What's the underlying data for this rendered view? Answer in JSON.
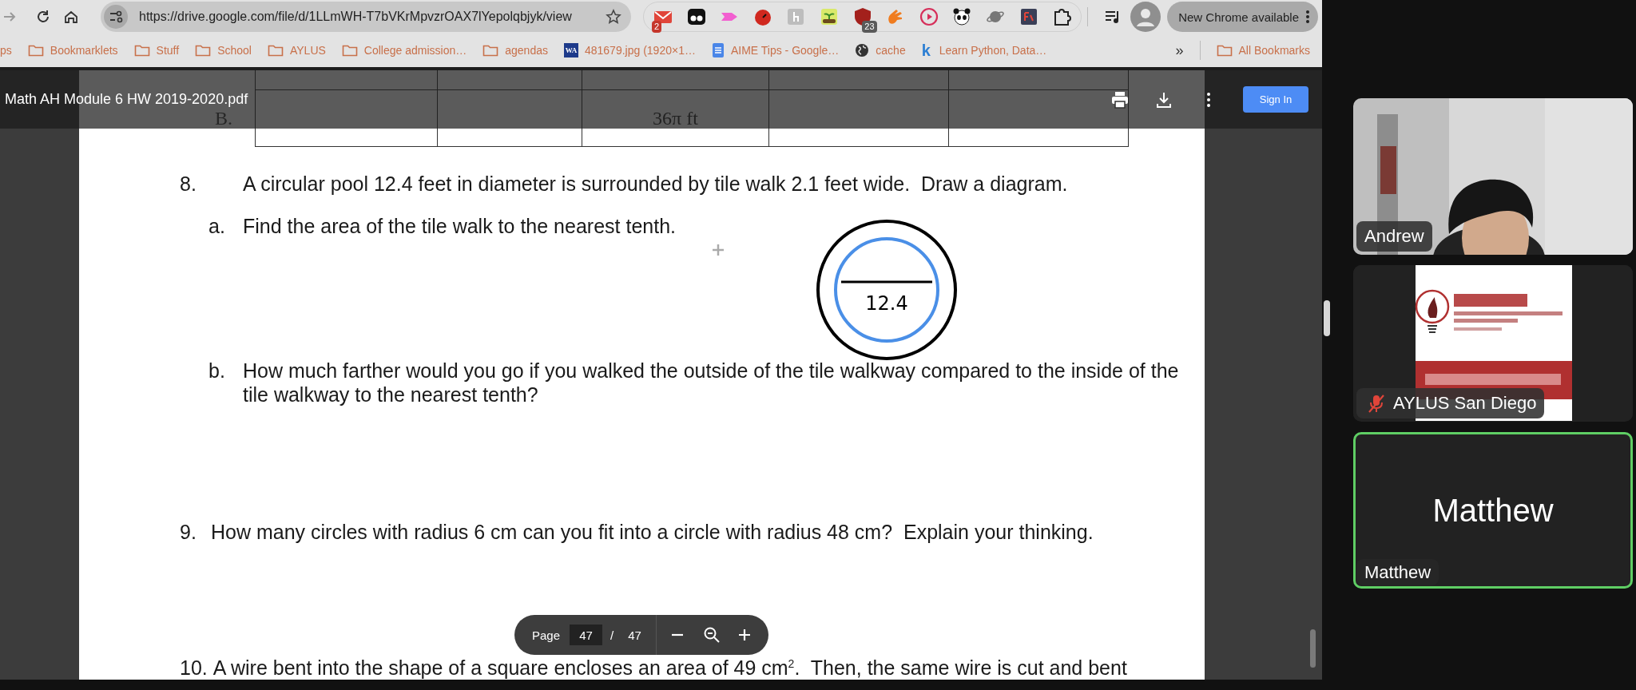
{
  "browser": {
    "url": "https://drive.google.com/file/d/1LLmWH-T7bVKrMpvzrOAX7lYepolqbjyk/view",
    "mail_badge": "2",
    "shield_badge": "23",
    "update_button": "New Chrome available",
    "bookmarks": [
      {
        "label": "ps",
        "kind": "plain"
      },
      {
        "label": "Bookmarklets",
        "kind": "folder"
      },
      {
        "label": "Stuff",
        "kind": "folder"
      },
      {
        "label": "School",
        "kind": "folder"
      },
      {
        "label": "AYLUS",
        "kind": "folder"
      },
      {
        "label": "College admission…",
        "kind": "folder"
      },
      {
        "label": "agendas",
        "kind": "folder"
      },
      {
        "label": "481679.jpg (1920×1…",
        "kind": "tile",
        "icon_text": "WA"
      },
      {
        "label": "AIME Tips - Google…",
        "kind": "doc"
      },
      {
        "label": "cache",
        "kind": "globe"
      },
      {
        "label": "Learn Python, Data…",
        "kind": "letter",
        "icon_text": "k"
      }
    ],
    "overflow": "»",
    "all_bookmarks": "All Bookmarks"
  },
  "viewer": {
    "title": "Math AH Module 6 HW 2019-2020.pdf",
    "sign_in": "Sign In",
    "table": {
      "row_label": "B.",
      "column_3": "36π ft"
    },
    "questions": [
      {
        "kind": "tabbed",
        "number": "8.",
        "text": "A circular pool 12.4 feet in diameter is surrounded by tile walk 2.1 feet wide.  Draw a diagram."
      },
      {
        "kind": "part",
        "number": "a.",
        "text": "Find the area of the tile walk to the nearest tenth.",
        "diagram_label": "12.4"
      },
      {
        "kind": "part",
        "number": "b.",
        "text": "How much farther would you go if you walked the outside of the tile walkway compared to the inside of the tile walkway to the nearest tenth?"
      },
      {
        "kind": "inline",
        "number": "9.",
        "text": "How many circles with radius 6 cm can you fit into a circle with radius 48 cm?  Explain your thinking."
      },
      {
        "kind": "inline",
        "number": "10.",
        "text": "A wire bent into the shape of a square encloses an area of 49 cm$^{2}$.  Then, the same wire is cut and bent"
      }
    ],
    "page_toolbar": {
      "label": "Page",
      "current": "47",
      "separator": "/",
      "total": "47"
    }
  },
  "meeting": {
    "participants": [
      {
        "name": "Andrew",
        "kind": "video",
        "muted": false,
        "speaking": false
      },
      {
        "name": "AYLUS San Diego",
        "muted": true,
        "speaking": false
      },
      {
        "name": "Matthew",
        "kind": "avatar",
        "display_name": "Matthew",
        "muted": false,
        "speaking": true
      }
    ]
  }
}
